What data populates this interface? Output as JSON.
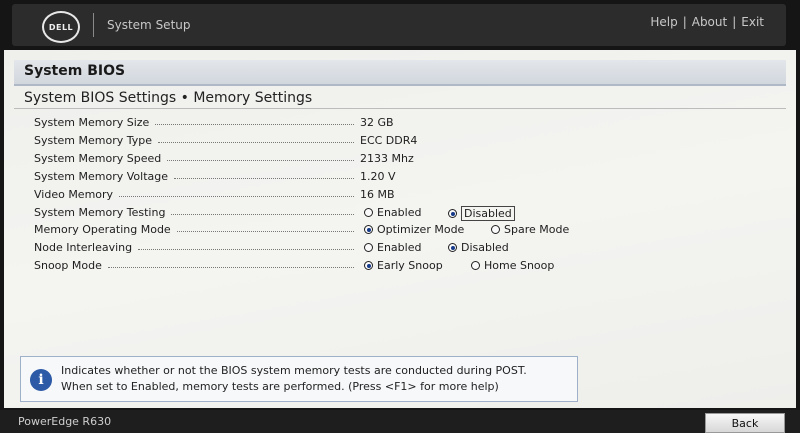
{
  "header": {
    "logo_text": "DELL",
    "app_title": "System Setup",
    "links": [
      "Help",
      "About",
      "Exit"
    ],
    "link_separator": "|"
  },
  "page": {
    "title": "System BIOS",
    "subtitle": "System BIOS Settings • Memory Settings"
  },
  "settings": [
    {
      "label": "System Memory Size",
      "value": "32 GB"
    },
    {
      "label": "System Memory Type",
      "value": "ECC DDR4"
    },
    {
      "label": "System Memory Speed",
      "value": "2133 Mhz"
    },
    {
      "label": "System Memory Voltage",
      "value": "1.20 V"
    },
    {
      "label": "Video Memory",
      "value": "16 MB"
    },
    {
      "label": "System Memory Testing",
      "options": [
        "Enabled",
        "Disabled"
      ],
      "selected": "Disabled"
    },
    {
      "label": "Memory Operating Mode",
      "options": [
        "Optimizer Mode",
        "Spare Mode"
      ],
      "selected": "Optimizer Mode"
    },
    {
      "label": "Node Interleaving",
      "options": [
        "Enabled",
        "Disabled"
      ],
      "selected": "Disabled"
    },
    {
      "label": "Snoop Mode",
      "options": [
        "Early Snoop",
        "Home Snoop"
      ],
      "selected": "Early Snoop"
    }
  ],
  "help": {
    "icon": "info-icon",
    "line1": "Indicates whether or not the BIOS system memory tests are conducted during POST.",
    "line2": "When set to Enabled, memory tests are performed. (Press <F1> for more help)"
  },
  "footer": {
    "model": "PowerEdge R630",
    "back_label": "Back"
  }
}
